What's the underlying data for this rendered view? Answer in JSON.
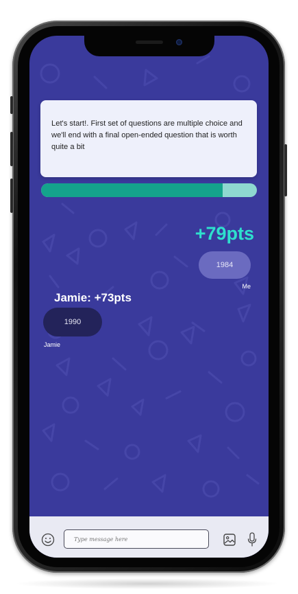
{
  "welcome_message": "Let's start!. First set of questions are multiple choice and we'll end with a final open-ended question that is worth quite a bit",
  "progress": 0.84,
  "me": {
    "points_label": "+79pts",
    "answer": "1984",
    "name": "Me"
  },
  "opponent": {
    "points_label": "Jamie: +73pts",
    "answer": "1990",
    "name": "Jamie"
  },
  "composer": {
    "placeholder": "Type message here"
  },
  "icons": {
    "emoji": "smiley-icon",
    "image": "image-icon",
    "mic": "microphone-icon"
  },
  "colors": {
    "background": "#3a3a9c",
    "accent": "#2ee0cd",
    "progress": "#14a38c",
    "progress_track": "#8ed8d0",
    "my_bubble": "#6b6bc0",
    "opponent_bubble": "#23235a"
  }
}
